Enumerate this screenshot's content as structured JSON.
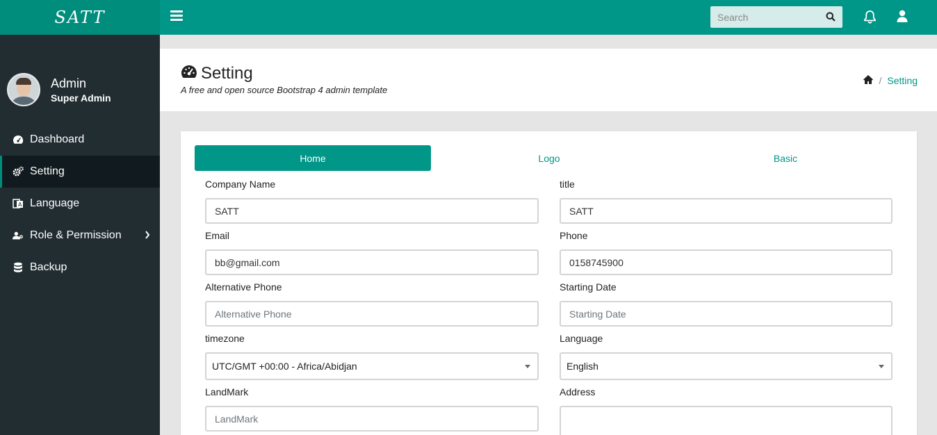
{
  "brand": "SATT",
  "user": {
    "name": "Admin",
    "role": "Super Admin"
  },
  "sidebar": {
    "items": [
      {
        "label": "Dashboard",
        "icon": "dashboard-icon",
        "active": false
      },
      {
        "label": "Setting",
        "icon": "cogs-icon",
        "active": true
      },
      {
        "label": "Language",
        "icon": "language-icon",
        "active": false
      },
      {
        "label": "Role & Permission",
        "icon": "user-key-icon",
        "active": false,
        "has_submenu": true
      },
      {
        "label": "Backup",
        "icon": "database-icon",
        "active": false
      }
    ]
  },
  "topbar": {
    "search_placeholder": "Search"
  },
  "page": {
    "title": "Setting",
    "subtitle": "A free and open source Bootstrap 4 admin template",
    "breadcrumb": "Setting"
  },
  "tabs": [
    "Home",
    "Logo",
    "Basic"
  ],
  "form": {
    "company_name": {
      "label": "Company Name",
      "value": "SATT",
      "placeholder": ""
    },
    "title": {
      "label": "title",
      "value": "SATT",
      "placeholder": ""
    },
    "email": {
      "label": "Email",
      "value": "bb@gmail.com",
      "placeholder": ""
    },
    "phone": {
      "label": "Phone",
      "value": "0158745900",
      "placeholder": ""
    },
    "alt_phone": {
      "label": "Alternative Phone",
      "value": "",
      "placeholder": "Alternative Phone"
    },
    "starting_date": {
      "label": "Starting Date",
      "value": "",
      "placeholder": "Starting Date"
    },
    "timezone": {
      "label": "timezone",
      "value": "UTC/GMT +00:00 - Africa/Abidjan"
    },
    "language": {
      "label": "Language",
      "value": "English"
    },
    "landmark": {
      "label": "LandMark",
      "value": "",
      "placeholder": "LandMark"
    },
    "address": {
      "label": "Address",
      "value": ""
    }
  },
  "colors": {
    "primary": "#009688",
    "sidebar_bg": "#222d32",
    "brand_bg": "#008d7c"
  }
}
